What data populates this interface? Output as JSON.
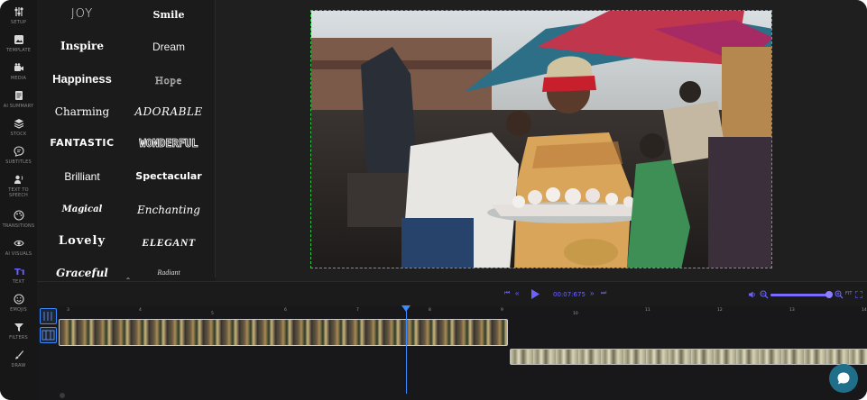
{
  "sidebar": {
    "items": [
      {
        "label": "SETUP",
        "icon": "sliders-icon"
      },
      {
        "label": "TEMPLATE",
        "icon": "template-icon"
      },
      {
        "label": "MEDIA",
        "icon": "media-icon"
      },
      {
        "label": "AI SUMMARY",
        "icon": "document-icon"
      },
      {
        "label": "STOCK",
        "icon": "layers-icon"
      },
      {
        "label": "SUBTITLES",
        "icon": "chat-bubble-icon"
      },
      {
        "label": "TEXT TO SPEECH",
        "label_lines": [
          "TEXT TO",
          "SPEECH"
        ],
        "icon": "speaker-person-icon"
      },
      {
        "label": "TRANSITIONS",
        "icon": "palette-icon"
      },
      {
        "label": "AI VISUALS",
        "icon": "eye-icon"
      },
      {
        "label": "TEXT",
        "icon": "text-icon",
        "active": true
      },
      {
        "label": "EMOJIS",
        "icon": "smiley-icon"
      },
      {
        "label": "FILTERS",
        "icon": "funnel-icon"
      },
      {
        "label": "DRAW",
        "icon": "brush-icon"
      }
    ]
  },
  "text_styles": [
    "JOY",
    "Smile",
    "Inspire",
    "Dream",
    "Happiness",
    "Hope",
    "Charming",
    "ADORABLE",
    "FANTASTIC",
    "WONDERFUL",
    "Brilliant",
    "Spectacular",
    "Magical",
    "Enchanting",
    "Lovely",
    "ELEGANT",
    "Graceful",
    "Radiant"
  ],
  "player": {
    "time": "00:07:675",
    "zoom_level": 0.95,
    "fit_label": "FIT"
  },
  "timeline": {
    "ticks": [
      "3",
      "4",
      "5",
      "6",
      "7",
      "8",
      "9",
      "10",
      "11",
      "12",
      "13",
      "14"
    ],
    "playhead_time": "7.675"
  },
  "colors": {
    "accent": "#6c63ff",
    "playhead": "#3a8bff",
    "preview_border": "#2ecc40",
    "chat": "#1f6f8b"
  }
}
